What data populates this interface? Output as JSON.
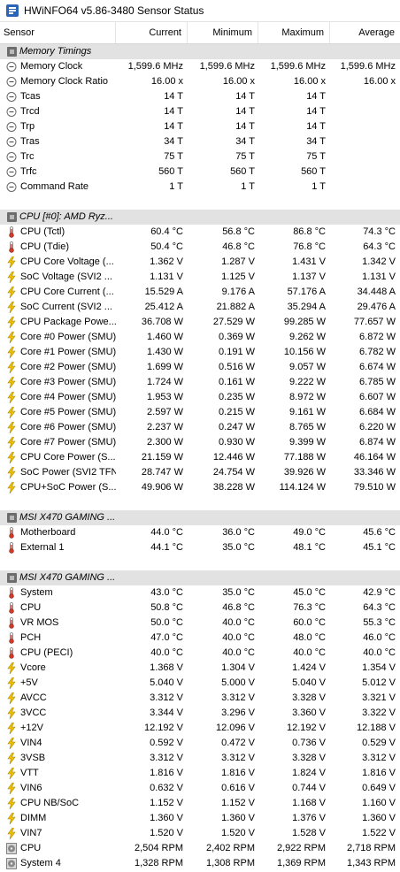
{
  "window": {
    "title": "HWiNFO64 v5.86-3480 Sensor Status"
  },
  "columns": {
    "sensor": "Sensor",
    "current": "Current",
    "minimum": "Minimum",
    "maximum": "Maximum",
    "average": "Average"
  },
  "colors": {
    "group_bg": "#e2e2e2",
    "voltage_icon": "#f2c200",
    "temperature_icon": "#d23a2a"
  },
  "groups": [
    {
      "name": "Memory Timings",
      "rows": [
        {
          "icon": "clock-icon",
          "label": "Memory Clock",
          "cur": "1,599.6 MHz",
          "min": "1,599.6 MHz",
          "max": "1,599.6 MHz",
          "avg": "1,599.6 MHz"
        },
        {
          "icon": "clock-icon",
          "label": "Memory Clock Ratio",
          "cur": "16.00 x",
          "min": "16.00 x",
          "max": "16.00 x",
          "avg": "16.00 x"
        },
        {
          "icon": "clock-icon",
          "label": "Tcas",
          "cur": "14 T",
          "min": "14 T",
          "max": "14 T",
          "avg": ""
        },
        {
          "icon": "clock-icon",
          "label": "Trcd",
          "cur": "14 T",
          "min": "14 T",
          "max": "14 T",
          "avg": ""
        },
        {
          "icon": "clock-icon",
          "label": "Trp",
          "cur": "14 T",
          "min": "14 T",
          "max": "14 T",
          "avg": ""
        },
        {
          "icon": "clock-icon",
          "label": "Tras",
          "cur": "34 T",
          "min": "34 T",
          "max": "34 T",
          "avg": ""
        },
        {
          "icon": "clock-icon",
          "label": "Trc",
          "cur": "75 T",
          "min": "75 T",
          "max": "75 T",
          "avg": ""
        },
        {
          "icon": "clock-icon",
          "label": "Trfc",
          "cur": "560 T",
          "min": "560 T",
          "max": "560 T",
          "avg": ""
        },
        {
          "icon": "clock-icon",
          "label": "Command Rate",
          "cur": "1 T",
          "min": "1 T",
          "max": "1 T",
          "avg": ""
        }
      ]
    },
    {
      "name": "CPU [#0]: AMD Ryz...",
      "rows": [
        {
          "icon": "thermometer-icon",
          "label": "CPU (Tctl)",
          "cur": "60.4 °C",
          "min": "56.8 °C",
          "max": "86.8 °C",
          "avg": "74.3 °C"
        },
        {
          "icon": "thermometer-icon",
          "label": "CPU (Tdie)",
          "cur": "50.4 °C",
          "min": "46.8 °C",
          "max": "76.8 °C",
          "avg": "64.3 °C"
        },
        {
          "icon": "lightning-icon",
          "label": "CPU Core Voltage (...",
          "cur": "1.362 V",
          "min": "1.287 V",
          "max": "1.431 V",
          "avg": "1.342 V"
        },
        {
          "icon": "lightning-icon",
          "label": "SoC Voltage (SVI2 ...",
          "cur": "1.131 V",
          "min": "1.125 V",
          "max": "1.137 V",
          "avg": "1.131 V"
        },
        {
          "icon": "lightning-icon",
          "label": "CPU Core Current (...",
          "cur": "15.529 A",
          "min": "9.176 A",
          "max": "57.176 A",
          "avg": "34.448 A"
        },
        {
          "icon": "lightning-icon",
          "label": "SoC Current (SVI2 ...",
          "cur": "25.412 A",
          "min": "21.882 A",
          "max": "35.294 A",
          "avg": "29.476 A"
        },
        {
          "icon": "lightning-icon",
          "label": "CPU Package Powe...",
          "cur": "36.708 W",
          "min": "27.529 W",
          "max": "99.285 W",
          "avg": "77.657 W"
        },
        {
          "icon": "lightning-icon",
          "label": "Core #0 Power (SMU)",
          "cur": "1.460 W",
          "min": "0.369 W",
          "max": "9.262 W",
          "avg": "6.872 W"
        },
        {
          "icon": "lightning-icon",
          "label": "Core #1 Power (SMU)",
          "cur": "1.430 W",
          "min": "0.191 W",
          "max": "10.156 W",
          "avg": "6.782 W"
        },
        {
          "icon": "lightning-icon",
          "label": "Core #2 Power (SMU)",
          "cur": "1.699 W",
          "min": "0.516 W",
          "max": "9.057 W",
          "avg": "6.674 W"
        },
        {
          "icon": "lightning-icon",
          "label": "Core #3 Power (SMU)",
          "cur": "1.724 W",
          "min": "0.161 W",
          "max": "9.222 W",
          "avg": "6.785 W"
        },
        {
          "icon": "lightning-icon",
          "label": "Core #4 Power (SMU)",
          "cur": "1.953 W",
          "min": "0.235 W",
          "max": "8.972 W",
          "avg": "6.607 W"
        },
        {
          "icon": "lightning-icon",
          "label": "Core #5 Power (SMU)",
          "cur": "2.597 W",
          "min": "0.215 W",
          "max": "9.161 W",
          "avg": "6.684 W"
        },
        {
          "icon": "lightning-icon",
          "label": "Core #6 Power (SMU)",
          "cur": "2.237 W",
          "min": "0.247 W",
          "max": "8.765 W",
          "avg": "6.220 W"
        },
        {
          "icon": "lightning-icon",
          "label": "Core #7 Power (SMU)",
          "cur": "2.300 W",
          "min": "0.930 W",
          "max": "9.399 W",
          "avg": "6.874 W"
        },
        {
          "icon": "lightning-icon",
          "label": "CPU Core Power (S...",
          "cur": "21.159 W",
          "min": "12.446 W",
          "max": "77.188 W",
          "avg": "46.164 W"
        },
        {
          "icon": "lightning-icon",
          "label": "SoC Power (SVI2 TFN)",
          "cur": "28.747 W",
          "min": "24.754 W",
          "max": "39.926 W",
          "avg": "33.346 W"
        },
        {
          "icon": "lightning-icon",
          "label": "CPU+SoC Power (S...",
          "cur": "49.906 W",
          "min": "38.228 W",
          "max": "114.124 W",
          "avg": "79.510 W"
        }
      ]
    },
    {
      "name": "MSI X470 GAMING ...",
      "rows": [
        {
          "icon": "thermometer-icon",
          "label": "Motherboard",
          "cur": "44.0 °C",
          "min": "36.0 °C",
          "max": "49.0 °C",
          "avg": "45.6 °C"
        },
        {
          "icon": "thermometer-icon",
          "label": "External 1",
          "cur": "44.1 °C",
          "min": "35.0 °C",
          "max": "48.1 °C",
          "avg": "45.1 °C"
        }
      ]
    },
    {
      "name": "MSI X470 GAMING ...",
      "rows": [
        {
          "icon": "thermometer-icon",
          "label": "System",
          "cur": "43.0 °C",
          "min": "35.0 °C",
          "max": "45.0 °C",
          "avg": "42.9 °C"
        },
        {
          "icon": "thermometer-icon",
          "label": "CPU",
          "cur": "50.8 °C",
          "min": "46.8 °C",
          "max": "76.3 °C",
          "avg": "64.3 °C"
        },
        {
          "icon": "thermometer-icon",
          "label": "VR MOS",
          "cur": "50.0 °C",
          "min": "40.0 °C",
          "max": "60.0 °C",
          "avg": "55.3 °C"
        },
        {
          "icon": "thermometer-icon",
          "label": "PCH",
          "cur": "47.0 °C",
          "min": "40.0 °C",
          "max": "48.0 °C",
          "avg": "46.0 °C"
        },
        {
          "icon": "thermometer-icon",
          "label": "CPU (PECI)",
          "cur": "40.0 °C",
          "min": "40.0 °C",
          "max": "40.0 °C",
          "avg": "40.0 °C"
        },
        {
          "icon": "lightning-icon",
          "label": "Vcore",
          "cur": "1.368 V",
          "min": "1.304 V",
          "max": "1.424 V",
          "avg": "1.354 V"
        },
        {
          "icon": "lightning-icon",
          "label": "+5V",
          "cur": "5.040 V",
          "min": "5.000 V",
          "max": "5.040 V",
          "avg": "5.012 V"
        },
        {
          "icon": "lightning-icon",
          "label": "AVCC",
          "cur": "3.312 V",
          "min": "3.312 V",
          "max": "3.328 V",
          "avg": "3.321 V"
        },
        {
          "icon": "lightning-icon",
          "label": "3VCC",
          "cur": "3.344 V",
          "min": "3.296 V",
          "max": "3.360 V",
          "avg": "3.322 V"
        },
        {
          "icon": "lightning-icon",
          "label": "+12V",
          "cur": "12.192 V",
          "min": "12.096 V",
          "max": "12.192 V",
          "avg": "12.188 V"
        },
        {
          "icon": "lightning-icon",
          "label": "VIN4",
          "cur": "0.592 V",
          "min": "0.472 V",
          "max": "0.736 V",
          "avg": "0.529 V"
        },
        {
          "icon": "lightning-icon",
          "label": "3VSB",
          "cur": "3.312 V",
          "min": "3.312 V",
          "max": "3.328 V",
          "avg": "3.312 V"
        },
        {
          "icon": "lightning-icon",
          "label": "VTT",
          "cur": "1.816 V",
          "min": "1.816 V",
          "max": "1.824 V",
          "avg": "1.816 V"
        },
        {
          "icon": "lightning-icon",
          "label": "VIN6",
          "cur": "0.632 V",
          "min": "0.616 V",
          "max": "0.744 V",
          "avg": "0.649 V"
        },
        {
          "icon": "lightning-icon",
          "label": "CPU NB/SoC",
          "cur": "1.152 V",
          "min": "1.152 V",
          "max": "1.168 V",
          "avg": "1.160 V"
        },
        {
          "icon": "lightning-icon",
          "label": "DIMM",
          "cur": "1.360 V",
          "min": "1.360 V",
          "max": "1.376 V",
          "avg": "1.360 V"
        },
        {
          "icon": "lightning-icon",
          "label": "VIN7",
          "cur": "1.520 V",
          "min": "1.520 V",
          "max": "1.528 V",
          "avg": "1.522 V"
        },
        {
          "icon": "fan-icon",
          "label": "CPU",
          "cur": "2,504 RPM",
          "min": "2,402 RPM",
          "max": "2,922 RPM",
          "avg": "2,718 RPM"
        },
        {
          "icon": "fan-icon",
          "label": "System 4",
          "cur": "1,328 RPM",
          "min": "1,308 RPM",
          "max": "1,369 RPM",
          "avg": "1,343 RPM"
        }
      ]
    }
  ]
}
